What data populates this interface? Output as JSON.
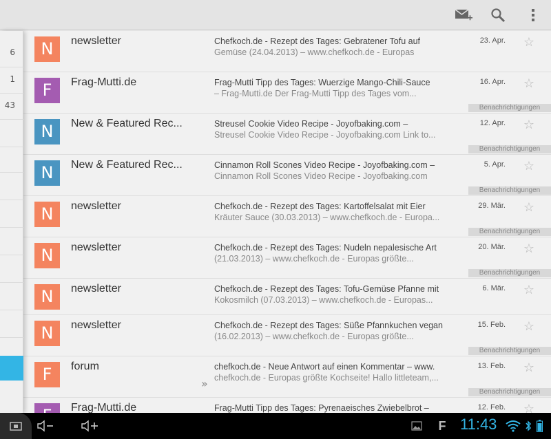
{
  "left_pane": {
    "counts": [
      "6",
      "1",
      "43"
    ]
  },
  "messages": [
    {
      "avatar": "N",
      "avatar_color": "#f4845f",
      "sender": "newsletter",
      "subject": "Chefkoch.de - Rezept des Tages: Gebratener Tofu auf",
      "snippet": "Gemüse (24.04.2013) – www.chefkoch.de - Europas",
      "date": "23. Apr.",
      "label": ""
    },
    {
      "avatar": "F",
      "avatar_color": "#a45cb1",
      "sender": "Frag-Mutti.de",
      "subject": "Frag-Mutti Tipp des Tages: Wuerzige Mango-Chili-Sauce",
      "snippet": "– Frag-Mutti.de Der Frag-Mutti Tipp des Tages vom...",
      "date": "16. Apr.",
      "label": "Benachrichtigungen"
    },
    {
      "avatar": "N",
      "avatar_color": "#4a95c1",
      "sender": "New & Featured Rec...",
      "subject": "Streusel Cookie Video Recipe - Joyofbaking.com –",
      "snippet": "Streusel Cookie Video Recipe - Joyofbaking.com Link to...",
      "date": "12. Apr.",
      "label": "Benachrichtigungen"
    },
    {
      "avatar": "N",
      "avatar_color": "#4a95c1",
      "sender": "New & Featured Rec...",
      "subject": "Cinnamon Roll Scones Video Recipe - Joyofbaking.com –",
      "snippet": "Cinnamon Roll Scones Video Recipe - Joyofbaking.com",
      "date": "5. Apr.",
      "label": "Benachrichtigungen"
    },
    {
      "avatar": "N",
      "avatar_color": "#f4845f",
      "sender": "newsletter",
      "subject": "Chefkoch.de - Rezept des Tages: Kartoffelsalat mit Eier",
      "snippet": "Kräuter Sauce (30.03.2013) – www.chefkoch.de - Europa...",
      "date": "29. Mär.",
      "label": "Benachrichtigungen"
    },
    {
      "avatar": "N",
      "avatar_color": "#f4845f",
      "sender": "newsletter",
      "subject": "Chefkoch.de - Rezept des Tages: Nudeln nepalesische Art",
      "snippet": "(21.03.2013) – www.chefkoch.de - Europas größte...",
      "date": "20. Mär.",
      "label": "Benachrichtigungen"
    },
    {
      "avatar": "N",
      "avatar_color": "#f4845f",
      "sender": "newsletter",
      "subject": "Chefkoch.de - Rezept des Tages: Tofu-Gemüse Pfanne mit",
      "snippet": "Kokosmilch (07.03.2013) – www.chefkoch.de - Europas...",
      "date": "6. Mär.",
      "label": ""
    },
    {
      "avatar": "N",
      "avatar_color": "#f4845f",
      "sender": "newsletter",
      "subject": "Chefkoch.de - Rezept des Tages: Süße Pfannkuchen vegan",
      "snippet": "(16.02.2013) – www.chefkoch.de - Europas größte...",
      "date": "15. Feb.",
      "label": "Benachrichtigungen"
    },
    {
      "avatar": "F",
      "avatar_color": "#f4845f",
      "sender": "forum",
      "subject": "chefkoch.de - Neue Antwort auf einen Kommentar – www.",
      "snippet": "chefkoch.de - Europas größte Kochseite! Hallo littleteam,...",
      "date": "13. Feb.",
      "label": "Benachrichtigungen",
      "forwarded": "»"
    },
    {
      "avatar": "F",
      "avatar_color": "#a45cb1",
      "sender": "Frag-Mutti.de",
      "subject": "Frag-Mutti Tipp des Tages: Pyrenaeisches Zwiebelbrot –",
      "snippet": "",
      "date": "12. Feb.",
      "label": ""
    }
  ],
  "status_bar": {
    "clock": "11:43",
    "accent": "#33b5e5"
  }
}
